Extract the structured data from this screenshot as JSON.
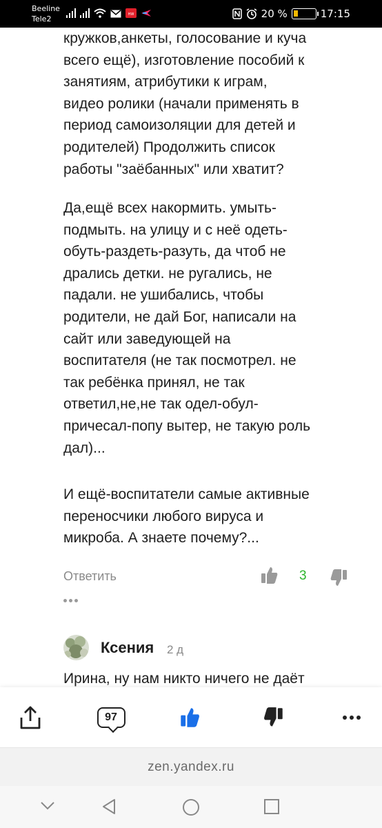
{
  "status_bar": {
    "carrier1": "Beeline",
    "carrier2": "Tele2",
    "battery_percent": "20 %",
    "battery_level": 0.2,
    "time": "17:15",
    "icons": [
      "signal-icon",
      "signal-icon",
      "wifi-icon",
      "mail-icon",
      "huawei-app-icon",
      "app-icon",
      "nfc-icon",
      "alarm-icon",
      "battery-icon"
    ]
  },
  "article": {
    "paragraph1": "кружков,анкеты, голосование и куча\nвсего ещё), изготовление пособий к\nзанятиям, атрибутики к играм,\nвидео ролики (начали применять в\nпериод самоизоляции для детей и\nродителей) Продолжить список\nработы \"заёбанных\" или хватит?",
    "paragraph2": "Да,ещё всех накормить. умыть-\nподмыть. на улицу и с неё одеть-\nобуть-раздеть-разуть, да чтоб не\nдрались детки. не ругались, не\nпадали. не ушибались, чтобы\nродители, не дай Бог, написали на\nсайт или заведующей на\nвоспитателя (не так посмотрел. не\nтак ребёнка принял, не так\nответил,не,не так одел-обул-\nпричесал-попу вытер, не такую роль\nдал)...",
    "paragraph3": "И ещё-воспитатели самые активные\nпереносчики любого вируса и\nмикроба. А знаете почему?..."
  },
  "comment_actions": {
    "reply_label": "Ответить",
    "likes": "3",
    "like_color": "#2cb52c"
  },
  "next_comment": {
    "author": "Ксения",
    "time": "2 д",
    "text": "Ирина, ну нам никто ничего не даёт"
  },
  "bottom_bar": {
    "comments_count": "97",
    "like_active_color": "#1a6fe8"
  },
  "url_bar": {
    "url": "zen.yandex.ru"
  }
}
